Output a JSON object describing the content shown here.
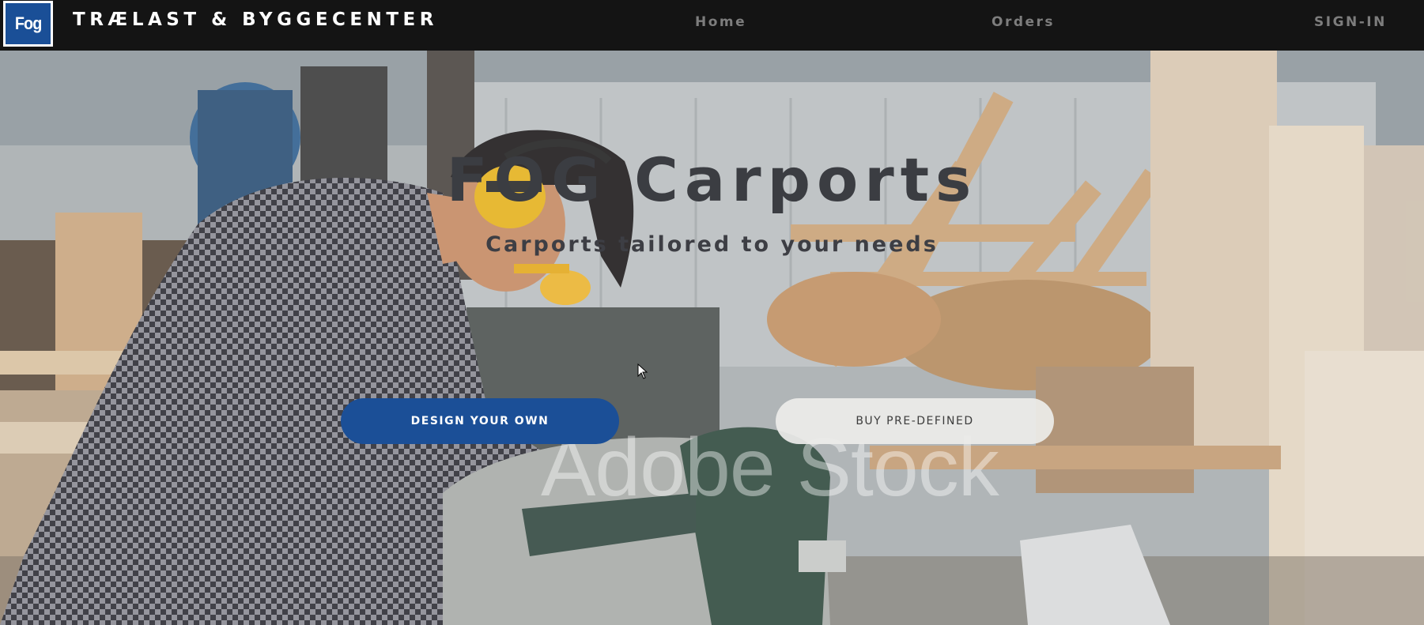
{
  "navbar": {
    "logo_text": "Fog",
    "brand": "TRÆLAST & BYGGECENTER",
    "links": [
      {
        "label": "Home"
      },
      {
        "label": "Orders"
      },
      {
        "label": "SIGN-IN"
      }
    ]
  },
  "hero": {
    "title": "FOG Carports",
    "subtitle": "Carports tailored to your needs",
    "primary_button": "DESIGN YOUR OWN",
    "secondary_button": "BUY PRE-DEFINED",
    "watermark": "Adobe Stock",
    "background_image": "man cutting wood with miter saw in workshop"
  },
  "colors": {
    "navbar_bg": "#141414",
    "brand_blue": "#1b4f97",
    "nav_link": "#7d7d7d",
    "hero_text": "#3b3d42"
  }
}
